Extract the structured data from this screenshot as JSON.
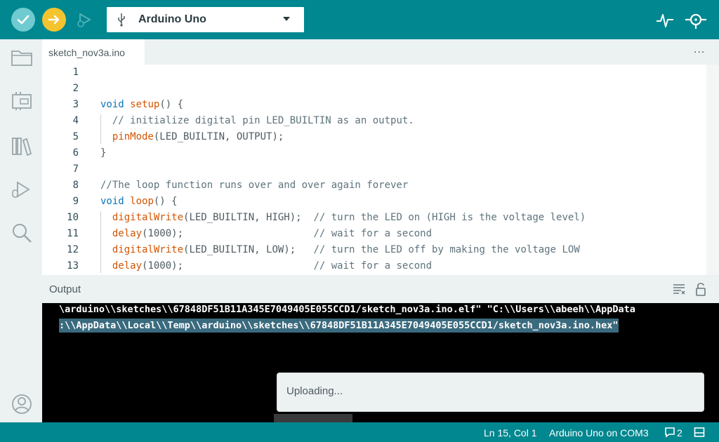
{
  "toolbar": {
    "board_name": "Arduino Uno",
    "verify_icon": "check-icon",
    "upload_icon": "arrow-right-icon",
    "debug_icon": "debug-icon",
    "colors": {
      "bar": "#00878f",
      "verify": "#6fcbd0",
      "upload": "#f4c430"
    }
  },
  "tab": {
    "filename": "sketch_nov3a.ino",
    "menu": "..."
  },
  "editor": {
    "lines": [
      {
        "n": "1",
        "parts": []
      },
      {
        "n": "2",
        "parts": []
      },
      {
        "n": "3",
        "parts": [
          {
            "t": "void",
            "c": "kw"
          },
          {
            "t": " "
          },
          {
            "t": "setup",
            "c": "fn"
          },
          {
            "t": "() {"
          }
        ]
      },
      {
        "n": "4",
        "parts": [
          {
            "t": "  "
          },
          {
            "t": "// initialize digital pin LED_BUILTIN as an output.",
            "c": "cm"
          }
        ]
      },
      {
        "n": "5",
        "parts": [
          {
            "t": "  "
          },
          {
            "t": "pinMode",
            "c": "fn"
          },
          {
            "t": "(LED_BUILTIN, OUTPUT);"
          }
        ]
      },
      {
        "n": "6",
        "parts": [
          {
            "t": "}"
          }
        ]
      },
      {
        "n": "7",
        "parts": []
      },
      {
        "n": "8",
        "parts": [
          {
            "t": "//The loop function runs over and over again forever",
            "c": "cm"
          }
        ]
      },
      {
        "n": "9",
        "parts": [
          {
            "t": "void",
            "c": "kw"
          },
          {
            "t": " "
          },
          {
            "t": "loop",
            "c": "fn"
          },
          {
            "t": "() {"
          }
        ]
      },
      {
        "n": "10",
        "parts": [
          {
            "t": "  "
          },
          {
            "t": "digitalWrite",
            "c": "fn"
          },
          {
            "t": "(LED_BUILTIN, HIGH);  "
          },
          {
            "t": "// turn the LED on (HIGH is the voltage level)",
            "c": "cm"
          }
        ]
      },
      {
        "n": "11",
        "parts": [
          {
            "t": "  "
          },
          {
            "t": "delay",
            "c": "fn"
          },
          {
            "t": "(1000);                      "
          },
          {
            "t": "// wait for a second",
            "c": "cm"
          }
        ]
      },
      {
        "n": "12",
        "parts": [
          {
            "t": "  "
          },
          {
            "t": "digitalWrite",
            "c": "fn"
          },
          {
            "t": "(LED_BUILTIN, LOW);   "
          },
          {
            "t": "// turn the LED off by making the voltage LOW",
            "c": "cm"
          }
        ]
      },
      {
        "n": "13",
        "parts": [
          {
            "t": "  "
          },
          {
            "t": "delay",
            "c": "fn"
          },
          {
            "t": "(1000);                      "
          },
          {
            "t": "// wait for a second",
            "c": "cm"
          }
        ]
      }
    ]
  },
  "output": {
    "title": "Output",
    "lines": [
      "\\arduino\\\\sketches\\\\67848DF51B11A345E7049405E055CCD1/sketch_nov3a.ino.elf\" \"C:\\\\Users\\\\abeeh\\\\AppData",
      ":\\\\AppData\\\\Local\\\\Temp\\\\arduino\\\\sketches\\\\67848DF51B11A345E7049405E055CCD1/sketch_nov3a.ino.hex\""
    ]
  },
  "toast": {
    "message": "Uploading..."
  },
  "status": {
    "position": "Ln 15, Col 1",
    "board_port": "Arduino Uno on COM3",
    "notification_count": "2"
  }
}
